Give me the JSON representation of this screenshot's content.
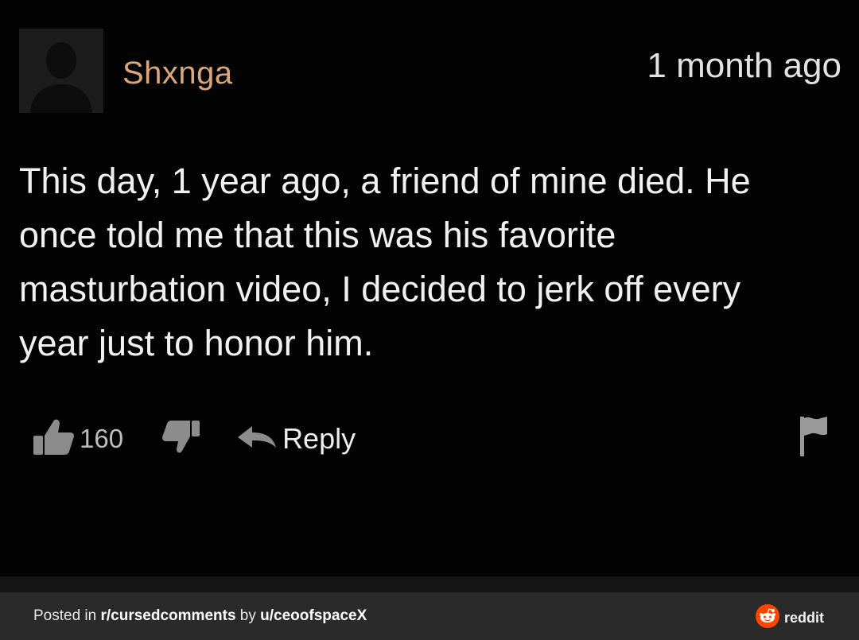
{
  "comment": {
    "username": "Shxnga",
    "timestamp": "1 month ago",
    "text": "This day, 1 year ago, a friend of mine died. He once told me that this was his favorite masturbation video, I decided to jerk off every year just to honor him.",
    "likes": "160",
    "reply_label": "Reply",
    "icons": {
      "avatar": "default-avatar-icon",
      "like": "thumbs-up-icon",
      "dislike": "thumbs-down-icon",
      "reply": "reply-arrow-icon",
      "flag": "flag-icon"
    },
    "colors": {
      "username": "#d9a778",
      "background": "#030303"
    }
  },
  "footer": {
    "prefix": "Posted in ",
    "subreddit": "r/cursedcomments",
    "middle": " by ",
    "user": "u/ceoofspaceX",
    "brand": "reddit",
    "brand_color": "#ff4500"
  }
}
